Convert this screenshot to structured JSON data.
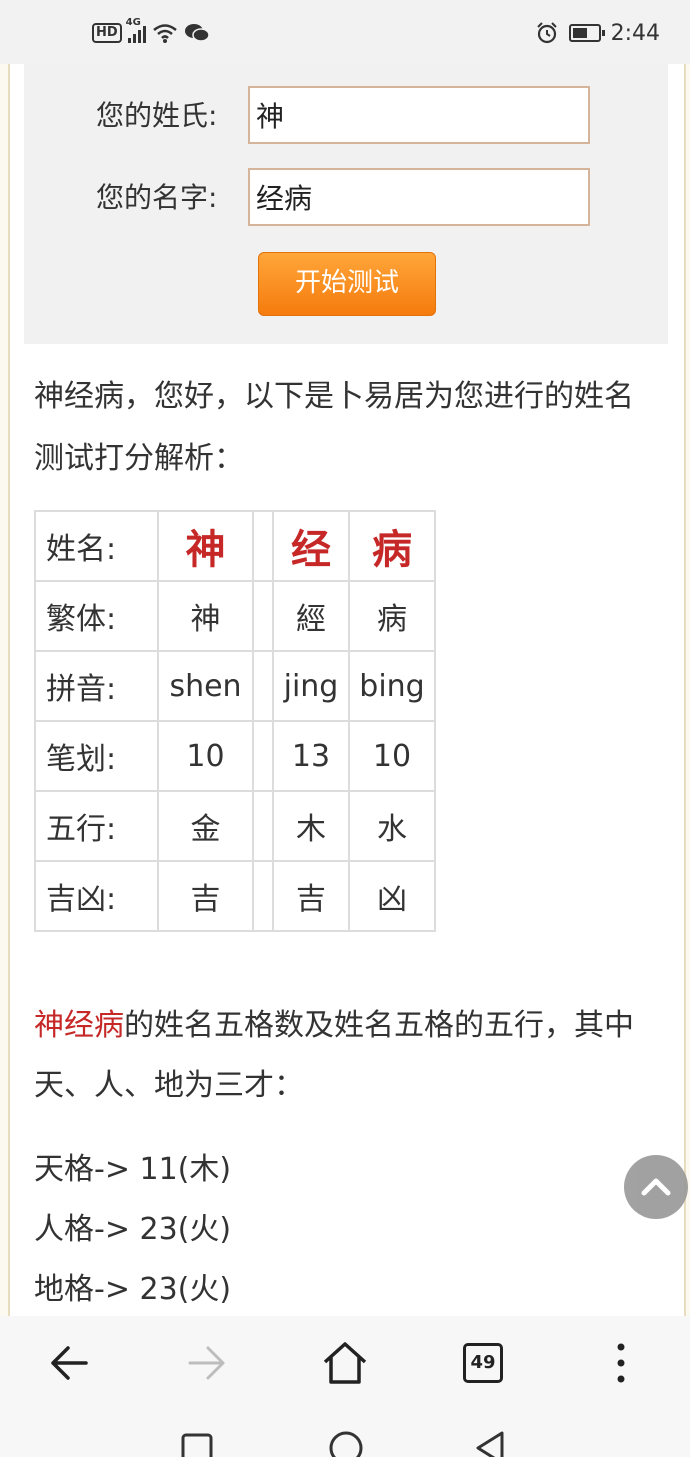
{
  "status_bar": {
    "hd": "HD",
    "network": "4G",
    "time": "2:44"
  },
  "form": {
    "surname_label": "您的姓氏:",
    "surname_value": "神",
    "name_label": "您的名字:",
    "name_value": "经病",
    "submit_label": "开始测试"
  },
  "intro": "神经病，您好，以下是卜易居为您进行的姓名测试打分解析：",
  "table": {
    "rows": [
      {
        "label": "姓名:",
        "c1": "神",
        "c2": "经",
        "c3": "病"
      },
      {
        "label": "繁体:",
        "c1": "神",
        "c2": "經",
        "c3": "病"
      },
      {
        "label": "拼音:",
        "c1": "shen",
        "c2": "jing",
        "c3": "bing"
      },
      {
        "label": "笔划:",
        "c1": "10",
        "c2": "13",
        "c3": "10"
      },
      {
        "label": "五行:",
        "c1": "金",
        "c2": "木",
        "c3": "水"
      },
      {
        "label": "吉凶:",
        "c1": "吉",
        "c2": "吉",
        "c3": "凶"
      }
    ]
  },
  "wuge": {
    "name_highlight": "神经病",
    "text": "的姓名五格数及姓名五格的五行，其中天、人、地为三才：",
    "items": [
      "天格-> 11(木)",
      "人格-> 23(火)",
      "地格-> 23(火)"
    ]
  },
  "toolbar": {
    "tab_count": "49"
  },
  "icons": {
    "back": "back-arrow-icon",
    "forward": "forward-arrow-icon",
    "home": "home-icon",
    "tabs": "tabs-icon",
    "menu": "more-vertical-icon",
    "scroll_top": "chevron-up-icon"
  },
  "colors": {
    "accent_red": "#c62828",
    "button_orange": "#f57b0d"
  }
}
